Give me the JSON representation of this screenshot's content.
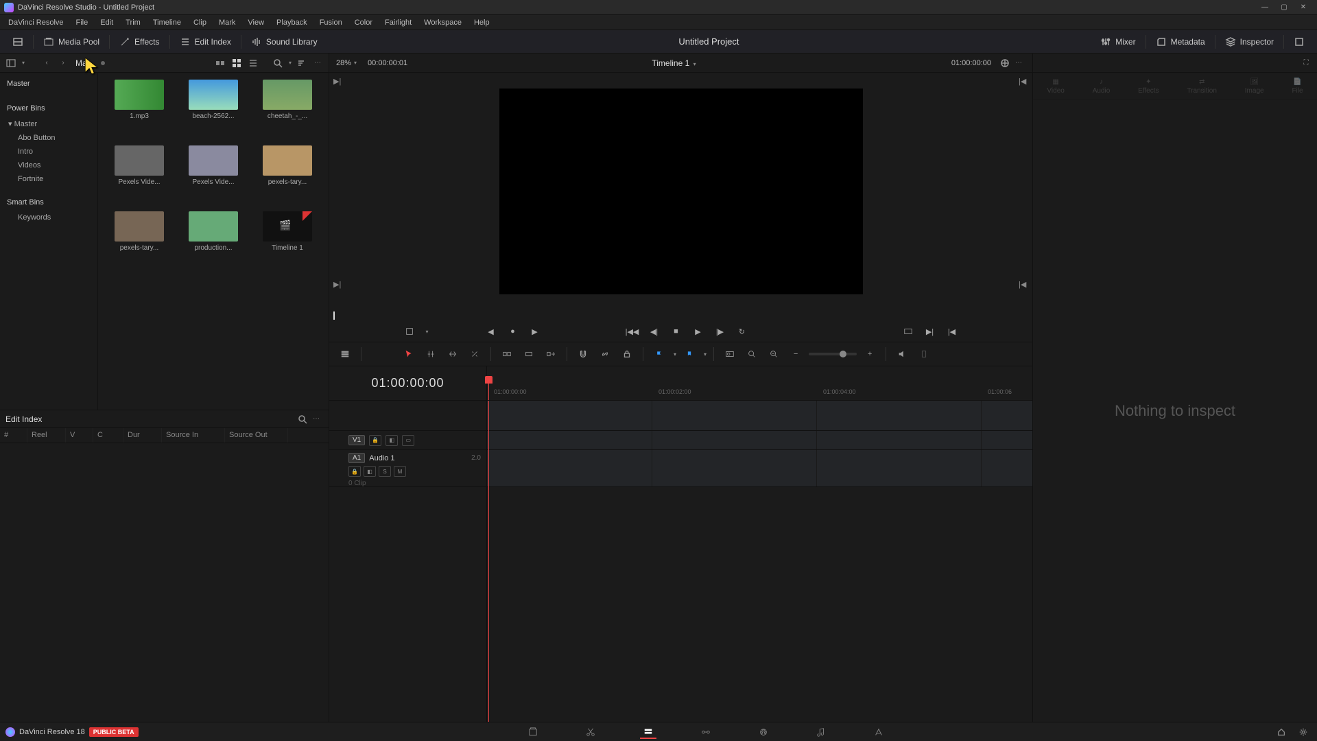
{
  "titlebar": {
    "title": "DaVinci Resolve Studio - Untitled Project"
  },
  "menubar": {
    "items": [
      "DaVinci Resolve",
      "File",
      "Edit",
      "Trim",
      "Timeline",
      "Clip",
      "Mark",
      "View",
      "Playback",
      "Fusion",
      "Color",
      "Fairlight",
      "Workspace",
      "Help"
    ]
  },
  "toolbar": {
    "media_pool": "Media Pool",
    "effects": "Effects",
    "edit_index": "Edit Index",
    "sound_library": "Sound Library",
    "project_title": "Untitled Project",
    "mixer": "Mixer",
    "metadata": "Metadata",
    "inspector": "Inspector"
  },
  "media_header": {
    "bin_label": "Ma..."
  },
  "viewer": {
    "percent": "28%",
    "source_tc": "00:00:00:01",
    "timeline_name": "Timeline 1",
    "record_tc": "01:00:00:00"
  },
  "bins": {
    "master": "Master",
    "power_bins": "Power Bins",
    "pb_master": "Master",
    "entries": [
      "Abo Button",
      "Intro",
      "Videos",
      "Fortnite"
    ],
    "smart_bins": "Smart Bins",
    "keywords": "Keywords"
  },
  "clips": [
    {
      "name": "1.mp3",
      "class": "thumb-audio"
    },
    {
      "name": "beach-2562...",
      "class": "thumb-beach"
    },
    {
      "name": "cheetah_-_...",
      "class": "thumb-cheetah"
    },
    {
      "name": "Pexels Vide...",
      "class": "thumb-video1"
    },
    {
      "name": "Pexels Vide...",
      "class": "thumb-video2"
    },
    {
      "name": "pexels-tary...",
      "class": "thumb-video3"
    },
    {
      "name": "pexels-tary...",
      "class": "thumb-video4"
    },
    {
      "name": "production...",
      "class": "thumb-video5"
    },
    {
      "name": "Timeline 1",
      "class": "thumb-tl"
    }
  ],
  "edit_index": {
    "title": "Edit Index",
    "columns": [
      "#",
      "Reel",
      "V",
      "C",
      "Dur",
      "Source In",
      "Source Out"
    ]
  },
  "timeline": {
    "tc": "01:00:00:00",
    "v1": "V1",
    "a1": "A1",
    "a1_name": "Audio 1",
    "a1_chan": "2.0",
    "clip_count": "0 Clip",
    "ticks": [
      "01:00:00:00",
      "01:00:02:00",
      "01:00:04:00",
      "01:00:06"
    ]
  },
  "inspector": {
    "tabs": [
      "Video",
      "Audio",
      "Effects",
      "Transition",
      "Image",
      "File"
    ],
    "empty": "Nothing to inspect"
  },
  "bottombar": {
    "app": "DaVinci Resolve 18",
    "beta": "PUBLIC BETA"
  }
}
